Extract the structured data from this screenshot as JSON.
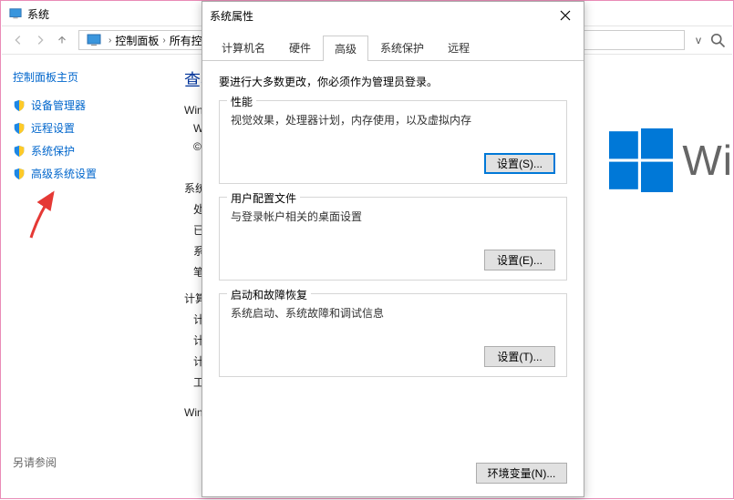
{
  "cp": {
    "title": "系统",
    "breadcrumb": {
      "item1": "控制面板",
      "item2": "所有控"
    },
    "sidebar": {
      "home": "控制面板主页",
      "links": [
        {
          "label": "设备管理器"
        },
        {
          "label": "远程设置"
        },
        {
          "label": "系统保护"
        },
        {
          "label": "高级系统设置"
        }
      ],
      "see_also": "另请参阅"
    },
    "main": {
      "title": "查看",
      "rows": [
        "Wind",
        "W",
        "©",
        "系统",
        "处",
        "已",
        "系",
        "笔",
        "计算",
        "计",
        "计",
        "计",
        "工",
        "Wind"
      ]
    }
  },
  "dialog": {
    "title": "系统属性",
    "tabs": [
      "计算机名",
      "硬件",
      "高级",
      "系统保护",
      "远程"
    ],
    "active_tab": 2,
    "note": "要进行大多数更改，你必须作为管理员登录。",
    "groups": [
      {
        "legend": "性能",
        "desc": "视觉效果，处理器计划，内存使用，以及虚拟内存",
        "btn": "设置(S)..."
      },
      {
        "legend": "用户配置文件",
        "desc": "与登录帐户相关的桌面设置",
        "btn": "设置(E)..."
      },
      {
        "legend": "启动和故障恢复",
        "desc": "系统启动、系统故障和调试信息",
        "btn": "设置(T)..."
      }
    ],
    "env_btn": "环境变量(N)..."
  },
  "winlogo_text": "Wi"
}
